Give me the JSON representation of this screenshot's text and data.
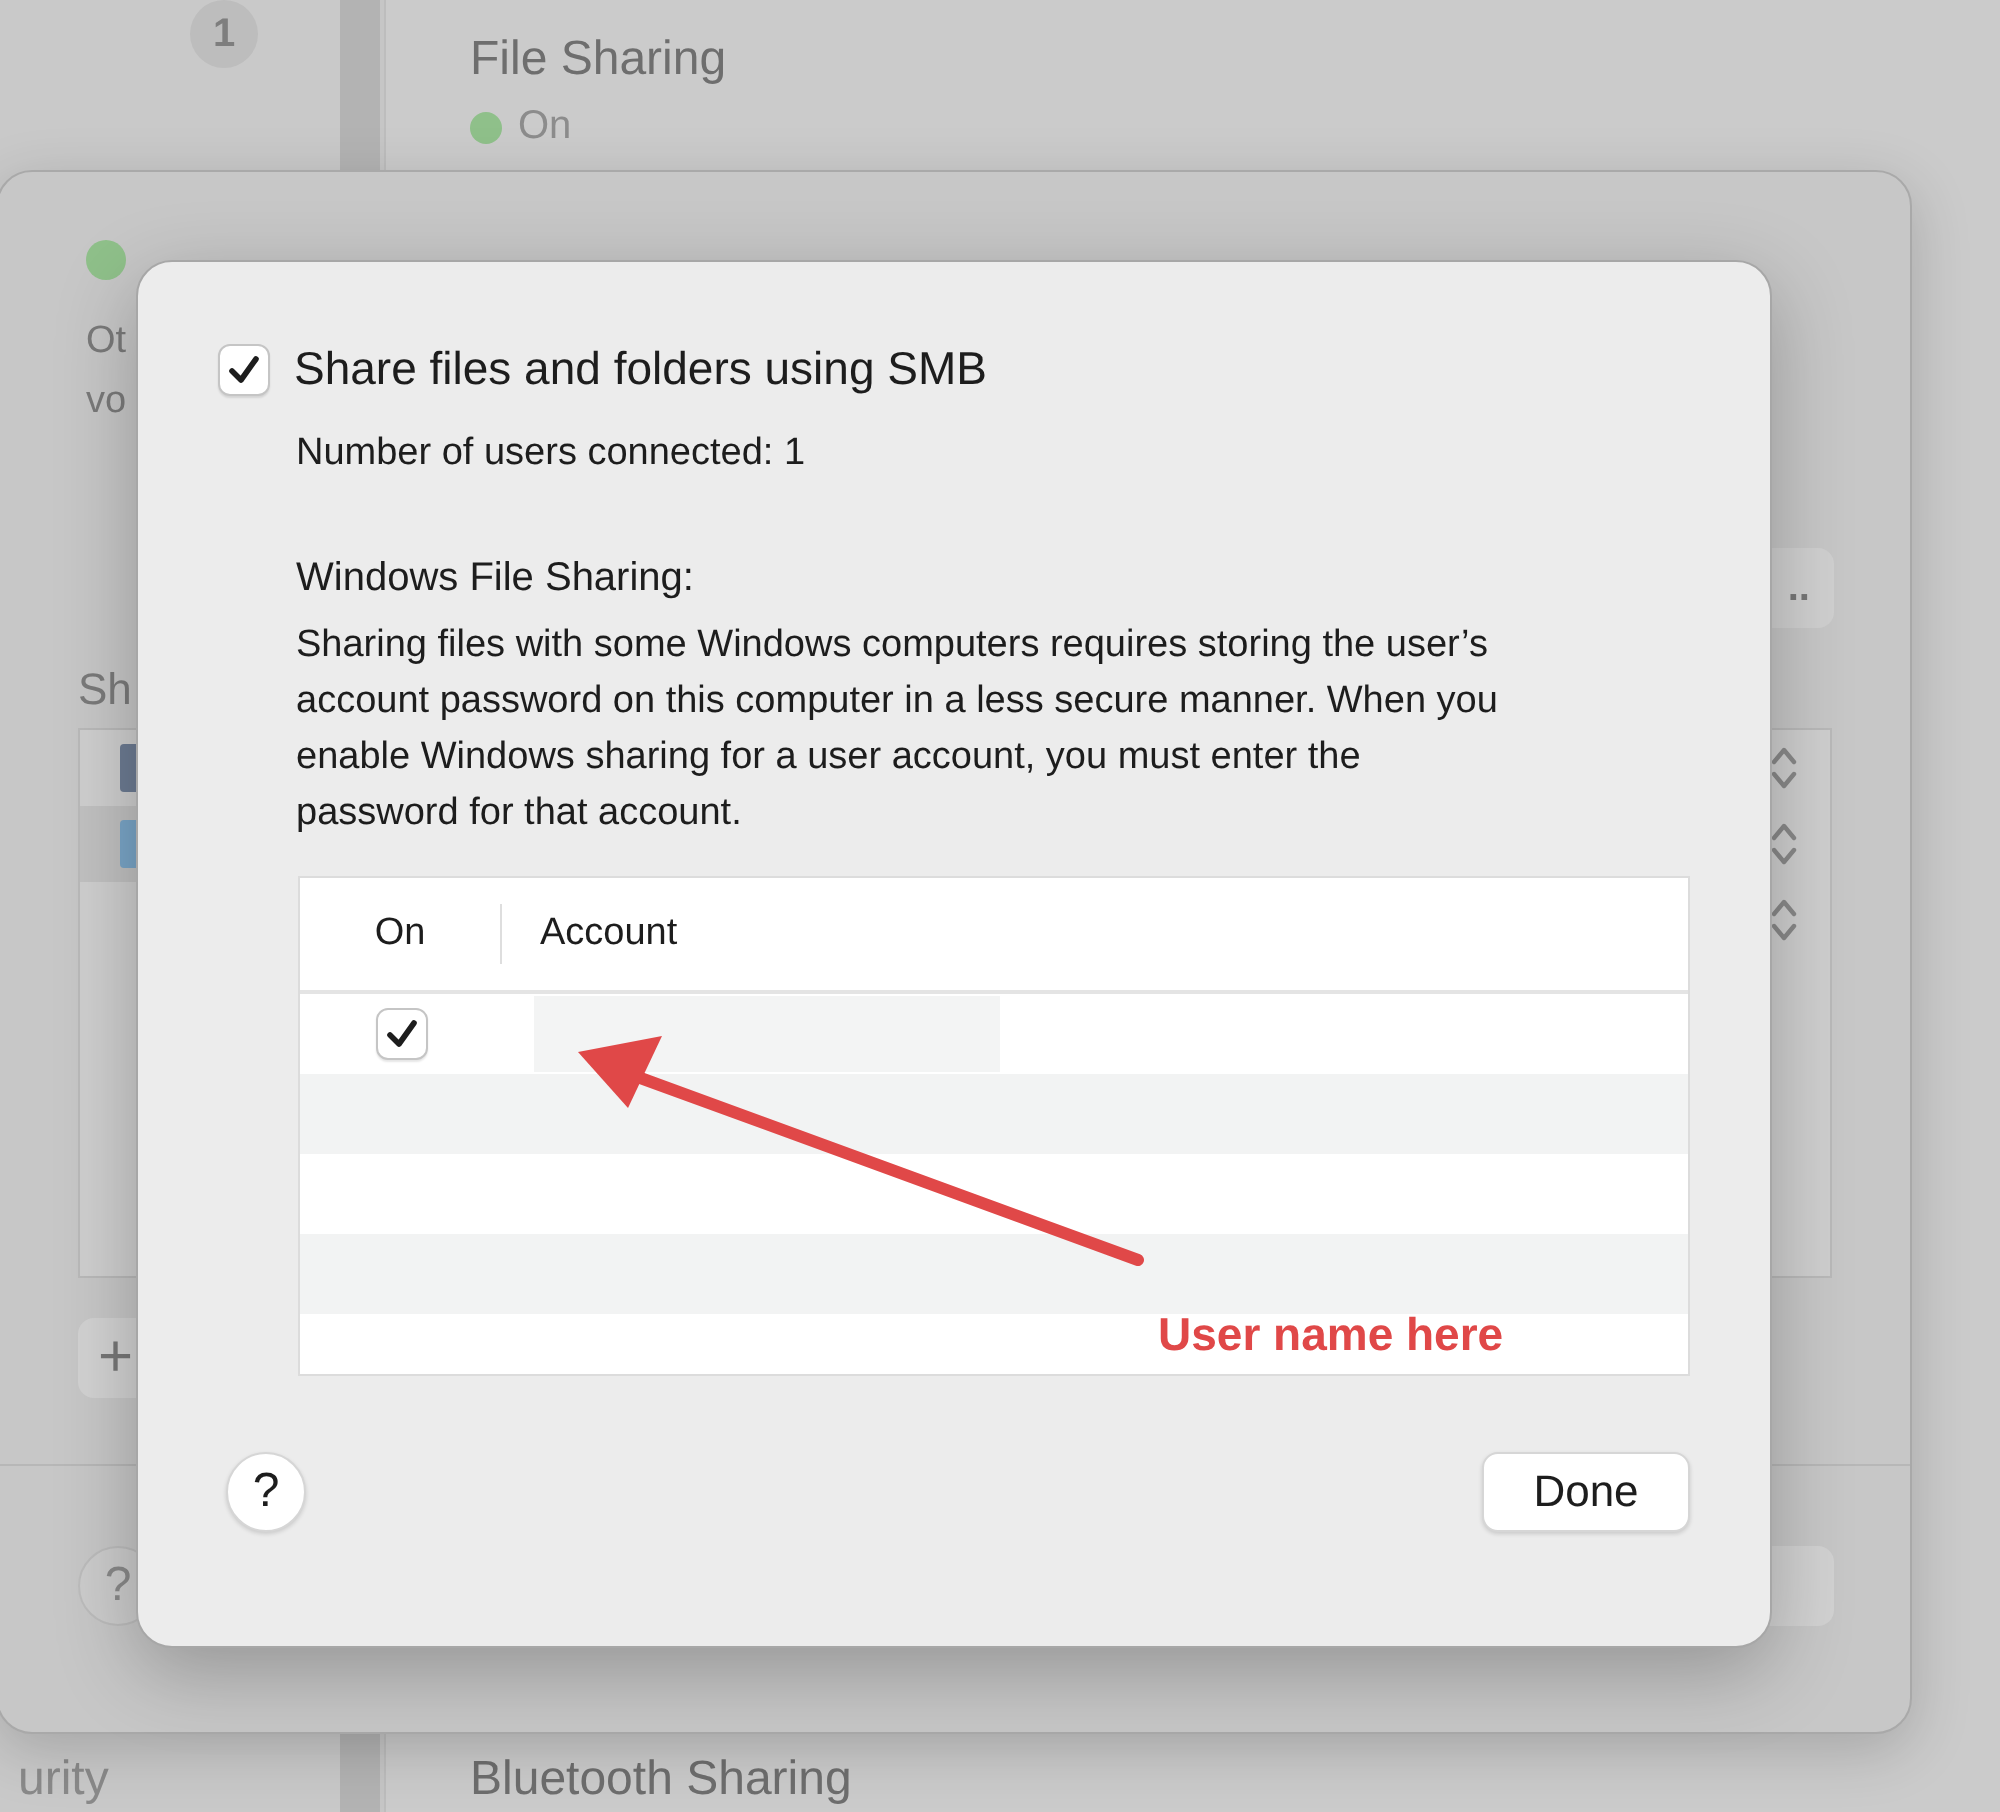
{
  "background": {
    "badge": "1",
    "items": [
      {
        "title": "File Sharing",
        "status": "On"
      },
      {
        "title": "Bluetooth Sharing"
      }
    ],
    "sidebar_fragment": "urity"
  },
  "sheet": {
    "fragments": [
      "Ot",
      "vo"
    ],
    "more_button": "..",
    "section_fragment": "Sh",
    "shared_items": [
      {
        "selected": false
      },
      {
        "selected": true
      }
    ],
    "add_button": "+",
    "help": "?"
  },
  "dialog": {
    "smb": {
      "label": "Share files and folders using SMB",
      "checked": true
    },
    "users_connected": "Number of users connected: 1",
    "heading": "Windows File Sharing:",
    "description": "Sharing files with some Windows computers requires storing the user’s account password on this computer in a less secure manner. When you enable Windows sharing for a user account, you must enter the password for that account.",
    "table": {
      "columns": [
        "On",
        "Account"
      ],
      "rows": [
        {
          "checked": true,
          "account_redacted": true
        }
      ]
    },
    "help": "?",
    "done": "Done"
  },
  "annotation": {
    "text": "User name here"
  }
}
